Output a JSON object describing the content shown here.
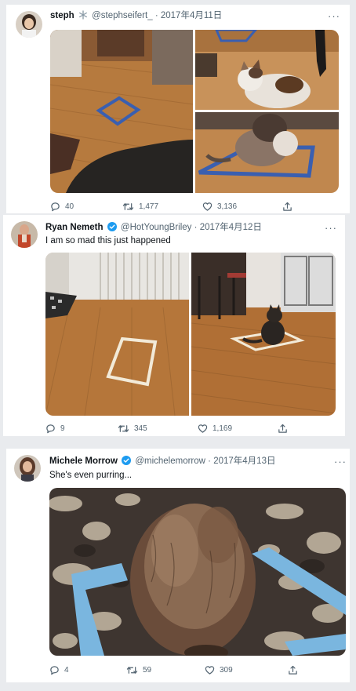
{
  "tweets": [
    {
      "name": "steph",
      "badge_icon": "snowflake-badge-icon",
      "handle": "@stephseifert_",
      "date": "2017年4月11日",
      "text": "",
      "more": "···",
      "replies": "40",
      "retweets": "1,477",
      "likes": "3,136"
    },
    {
      "name": "Ryan Nemeth",
      "badge_icon": "verified-badge-icon",
      "handle": "@HotYoungBriley",
      "date": "2017年4月12日",
      "text": "I am so mad this just happened",
      "more": "···",
      "replies": "9",
      "retweets": "345",
      "likes": "1,169"
    },
    {
      "name": "Michele Morrow",
      "badge_icon": "verified-badge-icon",
      "handle": "@michelemorrow",
      "date": "2017年4月13日",
      "text": "She's even purring...",
      "more": "···",
      "replies": "4",
      "retweets": "59",
      "likes": "309"
    }
  ],
  "colors": {
    "verified": "#1d9bf0",
    "muted": "#536471",
    "tape_blue": "#3a5fb0",
    "tape_light_blue": "#7ab6df",
    "floor_wood": "#b9793a"
  }
}
